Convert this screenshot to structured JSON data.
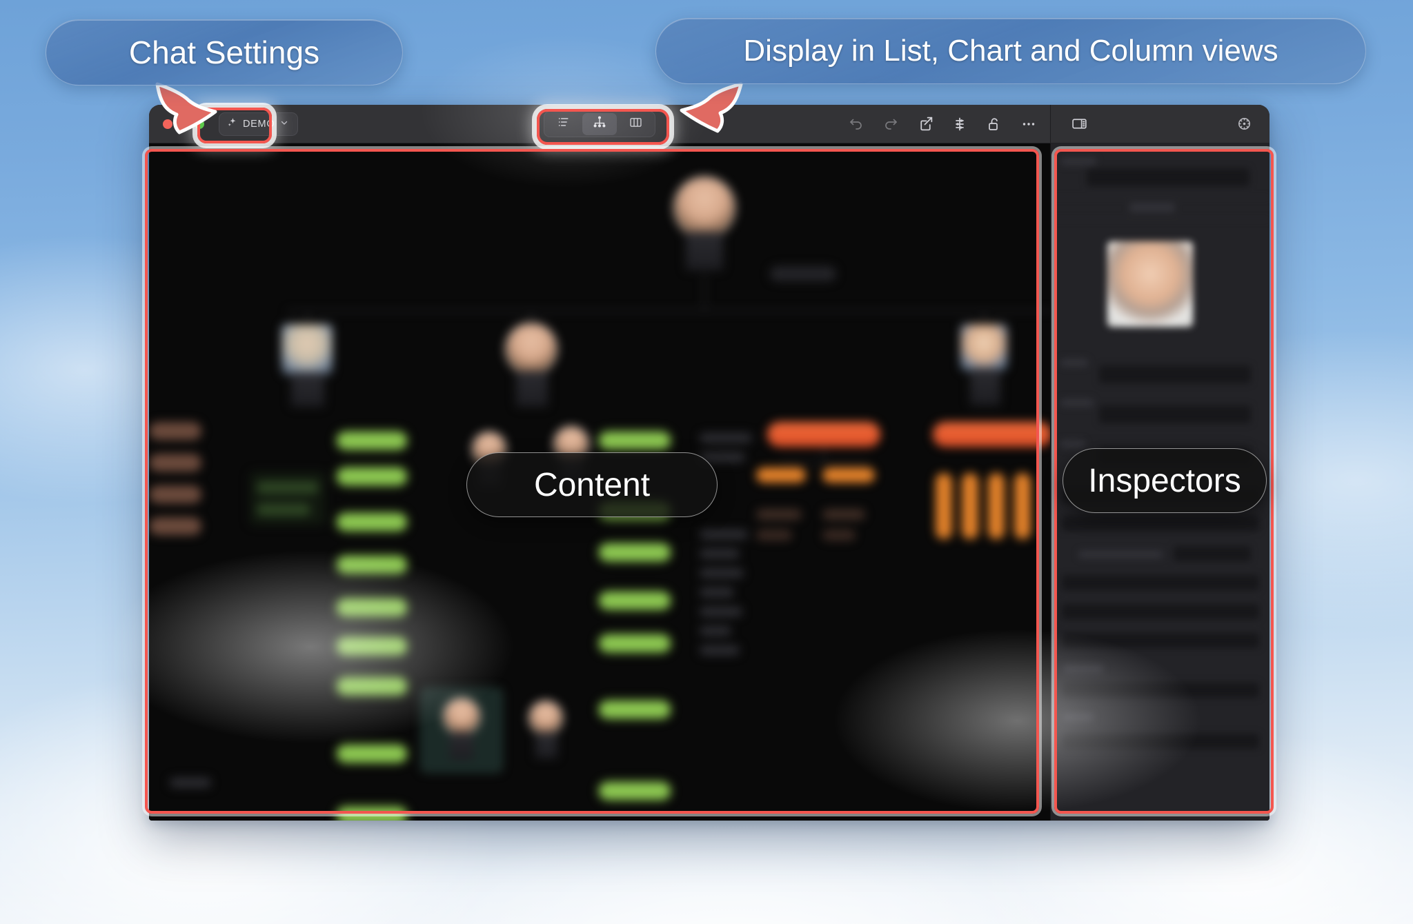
{
  "callouts": {
    "chat_settings": "Chat Settings",
    "views": "Display in List, Chart and Column views",
    "content": "Content",
    "inspectors": "Inspectors"
  },
  "window": {
    "titlebar": {
      "traffic_lights": [
        {
          "name": "close",
          "color": "#f3645b"
        },
        {
          "name": "minimize",
          "color": "#f6bd43"
        },
        {
          "name": "zoom",
          "color": "#5bc94b"
        }
      ],
      "chat_settings_chip": {
        "label": "DEMO",
        "leading_icon": "sparkle-icon",
        "trailing_icon": "chevron-down-icon"
      },
      "view_segmented_control": {
        "selected": "chart",
        "options": [
          {
            "id": "list",
            "icon": "list-view-icon",
            "label": "List",
            "selected": false
          },
          {
            "id": "chart",
            "icon": "chart-view-icon",
            "label": "Chart",
            "selected": true
          },
          {
            "id": "column",
            "icon": "column-view-icon",
            "label": "Column",
            "selected": false
          }
        ]
      },
      "actions": [
        {
          "id": "undo",
          "icon": "undo-icon",
          "enabled": false
        },
        {
          "id": "redo",
          "icon": "redo-icon",
          "enabled": false
        },
        {
          "id": "share",
          "icon": "share-icon",
          "enabled": true
        },
        {
          "id": "filters",
          "icon": "sliders-icon",
          "enabled": true
        },
        {
          "id": "lock",
          "icon": "unlock-icon",
          "enabled": true
        },
        {
          "id": "more",
          "icon": "ellipsis-icon",
          "enabled": true
        }
      ],
      "inspector_toggle_icon": "sidebar-right-icon",
      "settings_icon": "gear-icon"
    },
    "accent_highlight_color": "#f4564f",
    "canvas_background": "#090909",
    "inspector_background": "#232327"
  },
  "chart_data": {
    "type": "org-chart",
    "title": "",
    "note": "Blurred organization chart canvas: avatar person nodes linked to colored record bars.",
    "node_colors": {
      "green": "#8cc751",
      "green_dim": "#2d4523",
      "orange": "#e2812a",
      "red": "#ef6a3a",
      "brown": "#6b4a3c",
      "grey": "#242428"
    },
    "avatars": 9,
    "green_bars": 16,
    "orange_bars": 9,
    "levels": 4
  },
  "inspector_panel": {
    "photo": "person-photo",
    "field_rows": 14
  }
}
